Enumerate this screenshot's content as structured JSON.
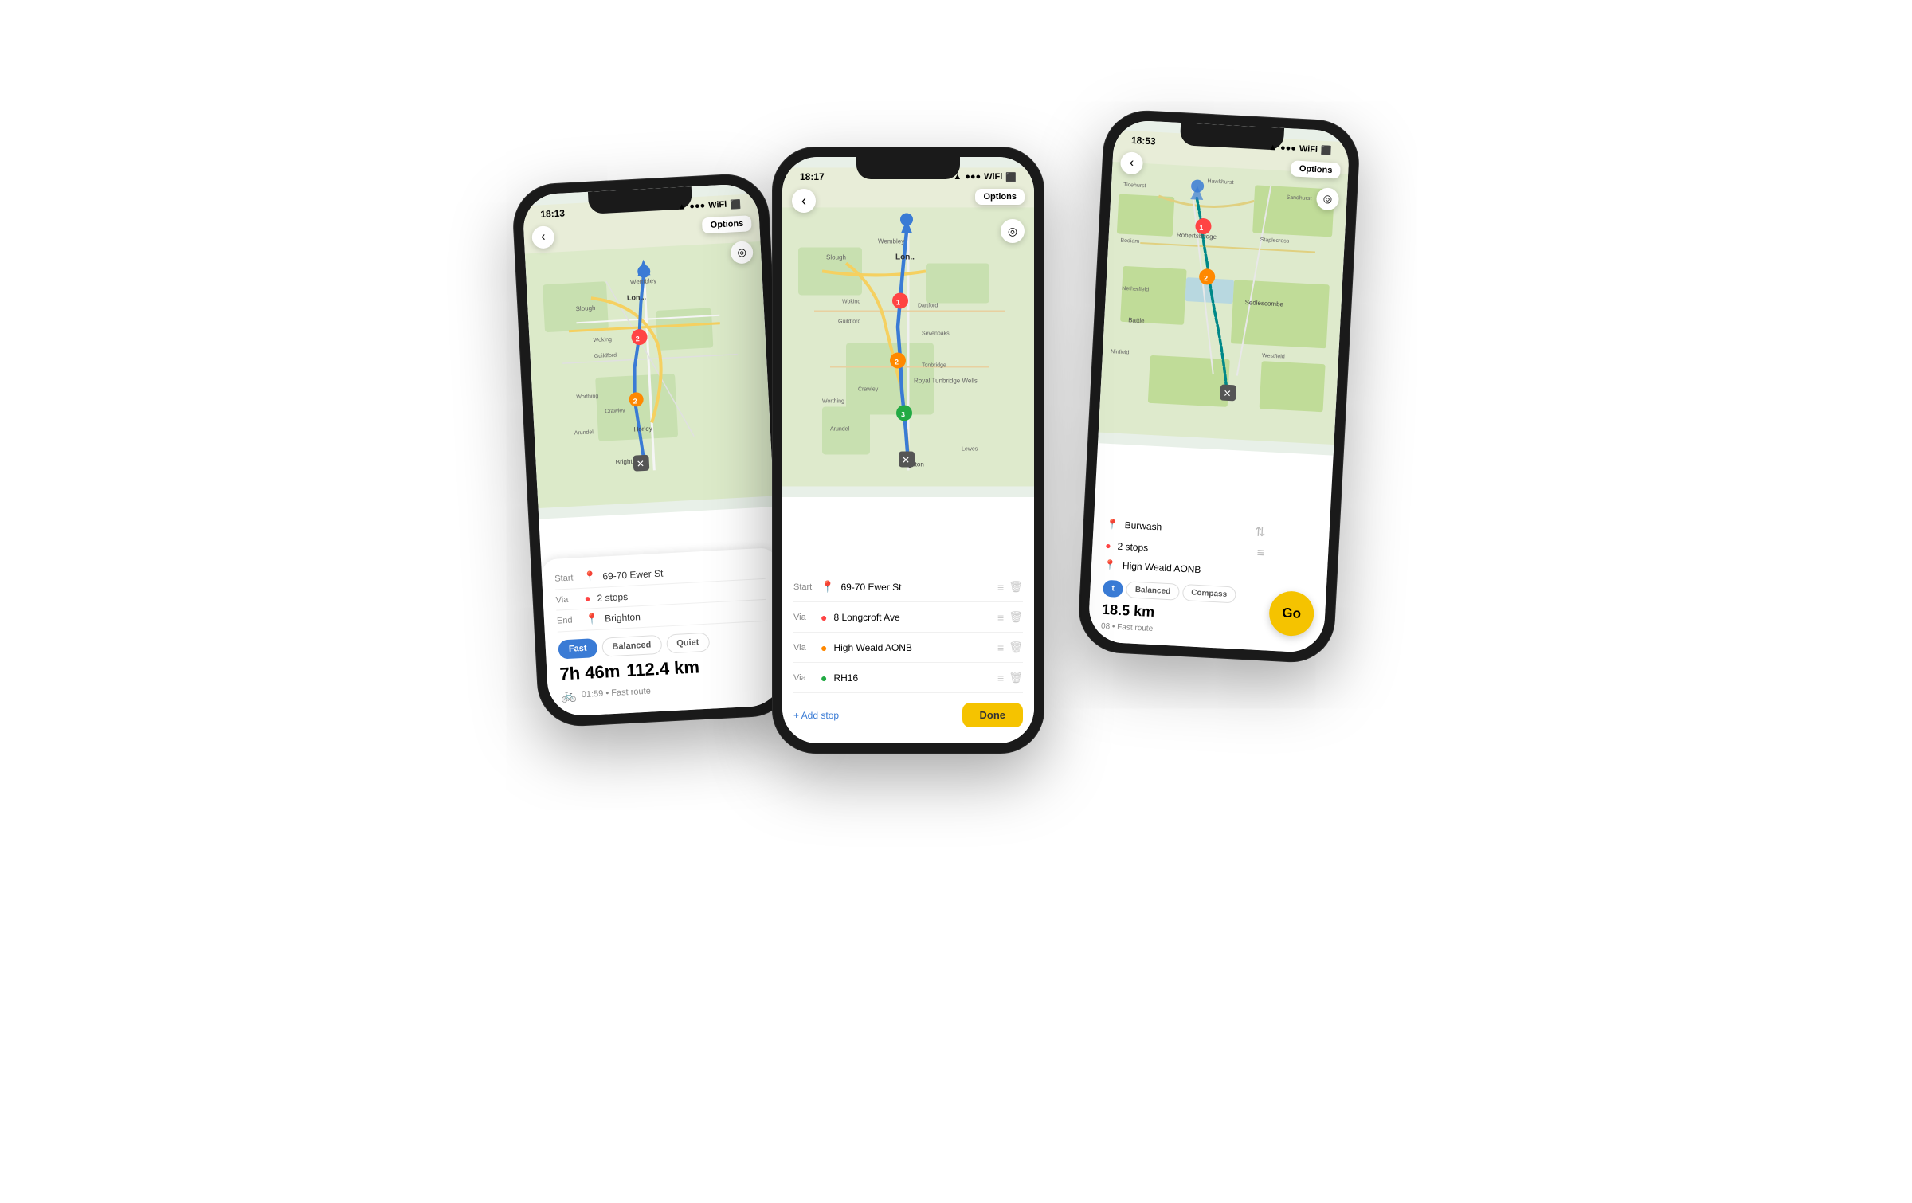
{
  "phones": {
    "left": {
      "status_time": "18:13",
      "status_icons": "▲ ◀ ●",
      "map_back": "‹",
      "options_label": "Options",
      "route": {
        "start_label": "Start",
        "start_icon": "📍",
        "start_value": "69-70 Ewer St",
        "via_label": "Via",
        "via_icon": "🔴",
        "via_value": "2 stops",
        "end_label": "End",
        "end_icon": "📍",
        "end_value": "Brighton"
      },
      "tabs": [
        "Fast",
        "Balanced",
        "Quiet"
      ],
      "active_tab": "Fast",
      "duration": "7h 46m",
      "distance": "112.4 km",
      "sub_info": "01:59 • Fast route"
    },
    "center": {
      "status_time": "18:17",
      "status_icons": "▲ ◀◀ ●",
      "map_back": "‹",
      "options_label": "Options",
      "waypoints": [
        {
          "label": "Start",
          "icon": "📍",
          "color": "blue",
          "text": "69-70 Ewer St"
        },
        {
          "label": "Via",
          "icon": "🔴",
          "color": "red",
          "text": "8 Longcroft Ave"
        },
        {
          "label": "Via",
          "icon": "🟠",
          "color": "orange",
          "text": "High Weald AONB"
        },
        {
          "label": "Via",
          "icon": "🟢",
          "color": "green",
          "text": "RH16"
        }
      ],
      "add_stop": "+ Add stop",
      "done_label": "Done"
    },
    "right": {
      "status_time": "18:53",
      "status_icons": "▲ ◀ ●",
      "map_back": "‹",
      "options_label": "Options",
      "route": {
        "start_value": "Burwash",
        "stops": "2 stops",
        "end_value": "High Weald AONB"
      },
      "tabs": [
        "t",
        "Balanced",
        "Compass"
      ],
      "distance": "18.5 km",
      "sub_info": "08 • Fast route",
      "go_label": "Go"
    }
  }
}
